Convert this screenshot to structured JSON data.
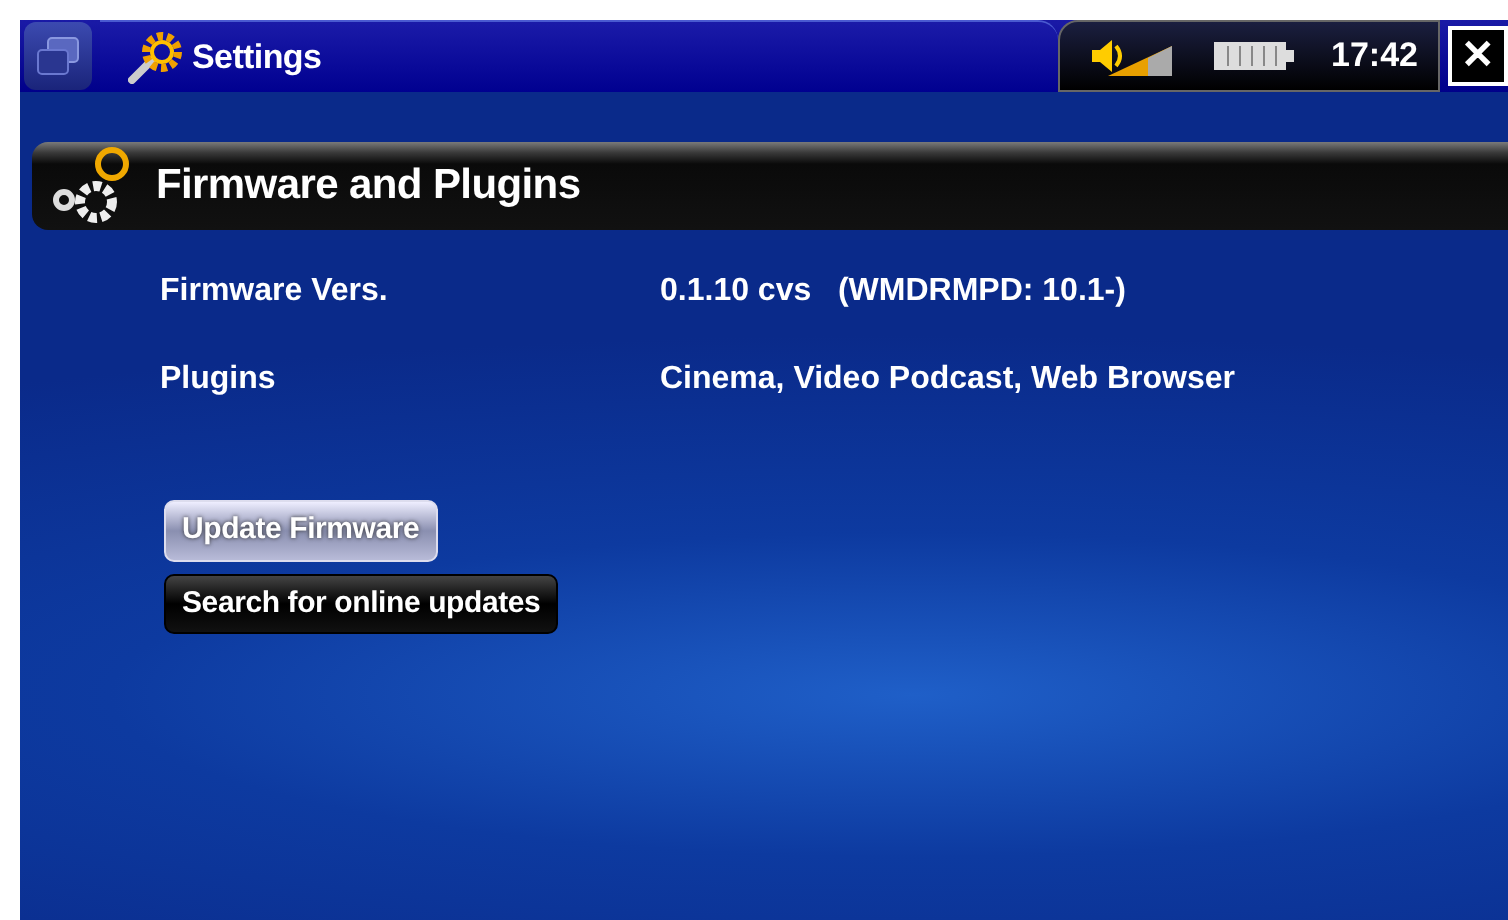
{
  "window": {
    "title": "Settings"
  },
  "status_bar": {
    "time": "17:42",
    "close": "✕"
  },
  "section": {
    "title": "Firmware and Plugins"
  },
  "info_rows": [
    {
      "label": "Firmware Vers.",
      "value": "0.1.10 cvs   (WMDRMPD: 10.1-)"
    },
    {
      "label": "Plugins",
      "value": "Cinema, Video Podcast, Web Browser"
    }
  ],
  "buttons": [
    {
      "label": "Update Firmware",
      "selected": true
    },
    {
      "label": "Search for online updates",
      "selected": false
    }
  ]
}
